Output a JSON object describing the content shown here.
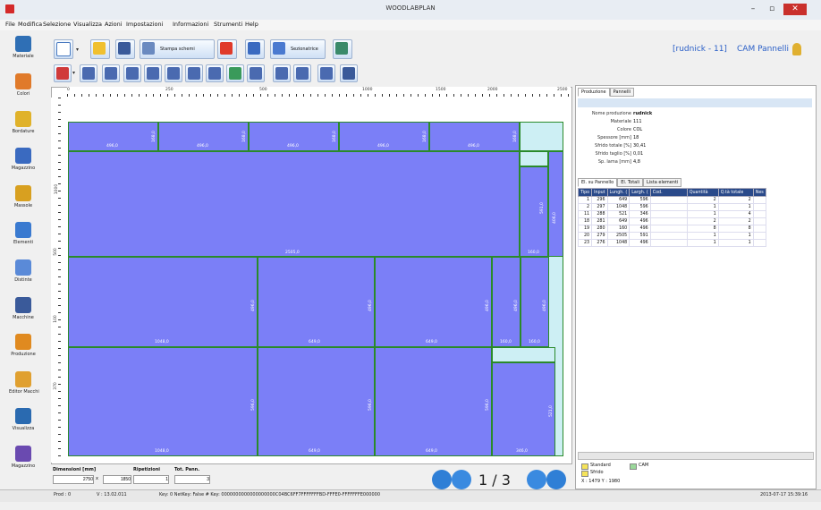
{
  "window": {
    "title": "WOODLABPLAN"
  },
  "menu": [
    "File",
    "Modifica",
    "Selezione",
    "Visualizza",
    "Azioni",
    "Impostazioni",
    "Informazioni",
    "Strumenti",
    "Help"
  ],
  "sidebar": [
    "Materiale",
    "Colori",
    "Bordature",
    "Magazzino",
    "Massole",
    "Elementi",
    "Distinte",
    "Macchine",
    "Produzione",
    "Editor Macchi",
    "Visualizza",
    "Magazzino"
  ],
  "toolbar": {
    "stampa_label": "Stampa schemi",
    "sezionatrice_label": "Sezionatrice"
  },
  "header": {
    "user": "[rudnick - 11]",
    "mode": "CAM Pannelli"
  },
  "ruler_h": [
    "0",
    "250",
    "500",
    "1000",
    "1500",
    "2000",
    "2500",
    "2750"
  ],
  "ruler_v": [
    "1000",
    "500",
    "100",
    "370"
  ],
  "piece_labels": {
    "row1": [
      "496,0",
      "496,0",
      "496,0",
      "496,0",
      "496,0"
    ],
    "row1_v": [
      "168,0",
      "168,0",
      "168,0",
      "168,0",
      "168,0"
    ],
    "big": "2505,0",
    "side_v": [
      "591,0",
      "406,0"
    ],
    "side_h": "160,0",
    "row3": [
      "1048,0",
      "649,0",
      "649,0",
      "160,0",
      "160,0"
    ],
    "row3_v": [
      "496,0",
      "496,0",
      "496,0",
      "496,0",
      "496,0"
    ],
    "row4": [
      "1048,0",
      "649,0",
      "649,0",
      "346,0"
    ],
    "row4_v": [
      "596,0",
      "596,0",
      "596,0",
      "521,0"
    ]
  },
  "bottom": {
    "dim_label": "Dimensioni [mm]",
    "dim_w": "2750",
    "dim_x": "x",
    "dim_h": "1850",
    "rip_label": "Ripetizioni",
    "rip_val": "1",
    "tot_label": "Tot. Pann.",
    "tot_val": "3",
    "page": "1 / 3"
  },
  "right": {
    "tabs": [
      "Produzione",
      "Pannelli"
    ],
    "props": [
      {
        "label": "Nome produzione",
        "value": "rudnick"
      },
      {
        "label": "Materiale",
        "value": "111"
      },
      {
        "label": "Colore",
        "value": "COL"
      },
      {
        "label": "Spessore [mm]",
        "value": "18"
      },
      {
        "label": "Sfrido totale [%]",
        "value": "30,41"
      },
      {
        "label": "Sfrido taglio [%]",
        "value": "0,01"
      },
      {
        "label": "Sp. lama [mm]",
        "value": "4,8"
      }
    ],
    "subtabs": [
      "El. su Pannello",
      "El. Totali",
      "Lista elementi"
    ],
    "columns": [
      "Tipo",
      "Input",
      "Lungh. (",
      "Largh. (",
      "Cod.",
      "Quantità",
      "Q.tà totale",
      "Nes"
    ],
    "rows": [
      [
        "1",
        "296",
        "649",
        "596",
        "",
        "2",
        "2"
      ],
      [
        "2",
        "297",
        "1048",
        "596",
        "",
        "1",
        "1"
      ],
      [
        "11",
        "288",
        "521",
        "346",
        "",
        "1",
        "4"
      ],
      [
        "18",
        "281",
        "649",
        "496",
        "",
        "2",
        "2"
      ],
      [
        "19",
        "280",
        "160",
        "496",
        "",
        "8",
        "8"
      ],
      [
        "20",
        "279",
        "2505",
        "591",
        "",
        "1",
        "1"
      ],
      [
        "23",
        "276",
        "1048",
        "496",
        "",
        "1",
        "1"
      ]
    ],
    "legend": [
      "Standard",
      "Sfrido",
      "CAM"
    ],
    "coord": "X : 1479 Y : 1980"
  },
  "status": {
    "prod": "Prod : 0",
    "version": "V : 13.02.011",
    "key": "Key: 0  NetKey: False  # Key:  0000000000000000000C04BC6FF7FFFFFFFBD-FFFE0-FFFFFFFE000000",
    "datetime": "2013-07-17 15:39:16"
  },
  "colors": {
    "piece": "#7b7ff7",
    "scrap": "#cdeff4",
    "border": "#2a8a2a",
    "accent": "#2f7fd6"
  }
}
